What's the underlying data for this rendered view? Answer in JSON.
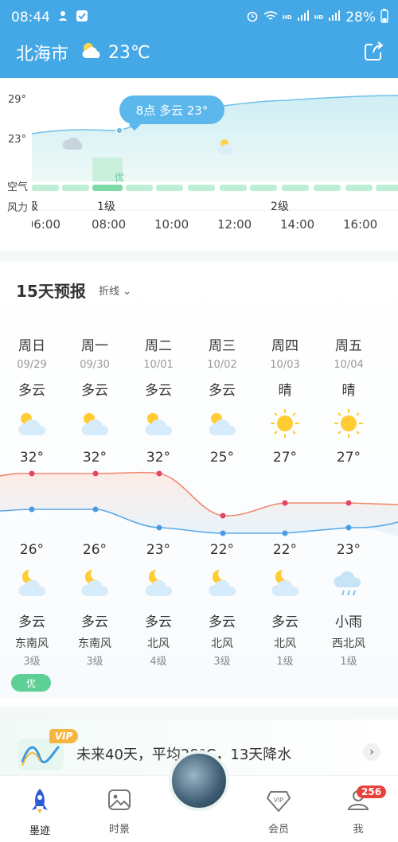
{
  "status_bar": {
    "time": "08:44",
    "battery": "28%",
    "hd1": "HD",
    "hd2": "HD",
    "net1": "5G",
    "net2": "5G"
  },
  "header": {
    "city": "北海市",
    "temp": "23℃"
  },
  "hourly": {
    "y_labels": [
      "29°",
      "23°"
    ],
    "row_air": "空气",
    "row_wind": "风力",
    "tooltip": "8点 多云 23°",
    "aqi_label": "优",
    "wind_levels": [
      "级",
      "1级",
      "2级"
    ],
    "times": [
      "06:00",
      "08:00",
      "10:00",
      "12:00",
      "14:00",
      "16:00"
    ]
  },
  "forecast": {
    "title": "15天预报",
    "toggle": "折线",
    "days": [
      {
        "name": "周日",
        "date": "09/29",
        "day_cond": "多云",
        "day_icon": "partly-cloudy-day-icon",
        "high": "32°",
        "low": "26°",
        "night_icon": "partly-cloudy-night-icon",
        "night_cond": "多云",
        "wind_dir": "东南风",
        "wind_lvl": "3级"
      },
      {
        "name": "周一",
        "date": "09/30",
        "day_cond": "多云",
        "day_icon": "partly-cloudy-day-icon",
        "high": "32°",
        "low": "26°",
        "night_icon": "partly-cloudy-night-icon",
        "night_cond": "多云",
        "wind_dir": "东南风",
        "wind_lvl": "3级"
      },
      {
        "name": "周二",
        "date": "10/01",
        "day_cond": "多云",
        "day_icon": "partly-cloudy-day-icon",
        "high": "32°",
        "low": "23°",
        "night_icon": "partly-cloudy-night-icon",
        "night_cond": "多云",
        "wind_dir": "北风",
        "wind_lvl": "4级"
      },
      {
        "name": "周三",
        "date": "10/02",
        "day_cond": "多云",
        "day_icon": "partly-cloudy-day-icon",
        "high": "25°",
        "low": "22°",
        "night_icon": "partly-cloudy-night-icon",
        "night_cond": "多云",
        "wind_dir": "北风",
        "wind_lvl": "3级"
      },
      {
        "name": "周四",
        "date": "10/03",
        "day_cond": "晴",
        "day_icon": "sun-icon",
        "high": "27°",
        "low": "22°",
        "night_icon": "partly-cloudy-night-icon",
        "night_cond": "多云",
        "wind_dir": "北风",
        "wind_lvl": "1级"
      },
      {
        "name": "周五",
        "date": "10/04",
        "day_cond": "晴",
        "day_icon": "sun-icon",
        "high": "27°",
        "low": "23°",
        "night_icon": "light-rain-icon",
        "night_cond": "小雨",
        "wind_dir": "西北风",
        "wind_lvl": "1级"
      }
    ],
    "aqi_pill": "优"
  },
  "vip": {
    "badge": "VIP",
    "text": "未来40天，平均28°C，13天降水"
  },
  "nav": {
    "items": [
      "墨迹",
      "时景",
      "会员",
      "我"
    ],
    "badge": "256"
  },
  "colors": {
    "header": "#44a8e6",
    "high_line": "#f08a70",
    "low_line": "#5aa8e8",
    "aqi": "#5ecf95"
  }
}
